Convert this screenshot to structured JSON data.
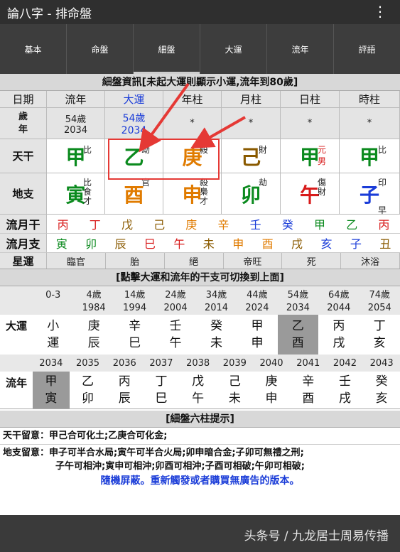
{
  "app_title": "論八字 - 排命盤",
  "tabs": [
    "基本",
    "命盤",
    "細盤",
    "大運",
    "流年",
    "評語"
  ],
  "detail_title": "細盤資訊[未起大運則顯示小運,流年到80歲]",
  "headers": [
    "日期",
    "流年",
    "大運",
    "年柱",
    "月柱",
    "日柱",
    "時柱"
  ],
  "age_label": "歲\n年",
  "age_row": [
    {
      "a": "54歲",
      "y": "2034"
    },
    {
      "a": "54歲",
      "y": "2034"
    },
    "*",
    "*",
    "*",
    "*"
  ],
  "stem_label": "天干",
  "stems": [
    {
      "c": "甲",
      "color": "#0b8a1e",
      "note": "比"
    },
    {
      "c": "乙",
      "color": "#0b8a1e",
      "note": "劫"
    },
    {
      "c": "庚",
      "color": "#e07b00",
      "note": "殺"
    },
    {
      "c": "己",
      "color": "#8a5a00",
      "note": "財"
    },
    {
      "c": "甲",
      "color": "#0b8a1e",
      "note": "元",
      "note2": "男"
    },
    {
      "c": "甲",
      "color": "#0b8a1e",
      "note": "比"
    }
  ],
  "branch_label": "地支",
  "branches": [
    {
      "c": "寅",
      "color": "#0b8a1e",
      "notes": [
        "比",
        "食",
        "才"
      ]
    },
    {
      "c": "酉",
      "color": "#e07b00",
      "notes": [
        "官"
      ]
    },
    {
      "c": "申",
      "color": "#e07b00",
      "notes": [
        "殺",
        "梟",
        "才"
      ]
    },
    {
      "c": "卯",
      "color": "#0b8a1e",
      "notes": [
        "劫"
      ]
    },
    {
      "c": "午",
      "color": "#d81b1b",
      "notes": [
        "傷",
        "財"
      ]
    },
    {
      "c": "子",
      "color": "#1a3cd8",
      "notes": [
        "印",
        "",
        "",
        "早"
      ]
    }
  ],
  "month_stem_label": "流月干",
  "month_stems": [
    [
      "丙",
      "#d81b1b"
    ],
    [
      "丁",
      "#d81b1b"
    ],
    [
      "戊",
      "#8a5a00"
    ],
    [
      "己",
      "#8a5a00"
    ],
    [
      "庚",
      "#e07b00"
    ],
    [
      "辛",
      "#e07b00"
    ],
    [
      "壬",
      "#1a3cd8"
    ],
    [
      "癸",
      "#1a3cd8"
    ],
    [
      "甲",
      "#0b8a1e"
    ],
    [
      "乙",
      "#0b8a1e"
    ],
    [
      "丙",
      "#d81b1b"
    ]
  ],
  "month_branch_label": "流月支",
  "month_branches": [
    [
      "寅",
      "#0b8a1e"
    ],
    [
      "卯",
      "#0b8a1e"
    ],
    [
      "辰",
      "#8a5a00"
    ],
    [
      "巳",
      "#d81b1b"
    ],
    [
      "午",
      "#d81b1b"
    ],
    [
      "未",
      "#8a5a00"
    ],
    [
      "申",
      "#e07b00"
    ],
    [
      "酉",
      "#e07b00"
    ],
    [
      "戌",
      "#8a5a00"
    ],
    [
      "亥",
      "#1a3cd8"
    ],
    [
      "子",
      "#1a3cd8"
    ],
    [
      "丑",
      "#8a5a00"
    ]
  ],
  "star_label": "星運",
  "stars": [
    "臨官",
    "胎",
    "絕",
    "帝旺",
    "死",
    "沐浴"
  ],
  "dayun_title": "[點擊大運和流年的干支可切換到上面]",
  "dayun_ages": [
    "0-3",
    "4歲",
    "14歲",
    "24歲",
    "34歲",
    "44歲",
    "54歲",
    "64歲",
    "74歲"
  ],
  "dayun_years": [
    "",
    "1984",
    "1994",
    "2004",
    "2014",
    "2024",
    "2034",
    "2044",
    "2054"
  ],
  "dayun_label": "大運",
  "dayun": [
    [
      "小",
      "運"
    ],
    [
      "庚",
      "辰"
    ],
    [
      "辛",
      "巳"
    ],
    [
      "壬",
      "午"
    ],
    [
      "癸",
      "未"
    ],
    [
      "甲",
      "申"
    ],
    [
      "乙",
      "酉"
    ],
    [
      "丙",
      "戌"
    ],
    [
      "丁",
      "亥"
    ]
  ],
  "liunian_years": [
    "2034",
    "2035",
    "2036",
    "2037",
    "2038",
    "2039",
    "2040",
    "2041",
    "2042",
    "2043"
  ],
  "liunian_label": "流年",
  "liunian": [
    [
      "甲",
      "寅"
    ],
    [
      "乙",
      "卯"
    ],
    [
      "丙",
      "辰"
    ],
    [
      "丁",
      "巳"
    ],
    [
      "戊",
      "午"
    ],
    [
      "己",
      "未"
    ],
    [
      "庚",
      "申"
    ],
    [
      "辛",
      "酉"
    ],
    [
      "壬",
      "戌"
    ],
    [
      "癸",
      "亥"
    ]
  ],
  "tips_title": "[細盤六柱提示]",
  "tip1": "天干留意：甲己合可化土;乙庚合可化金;",
  "tip2a": "地支留意：申子可半合水局;寅午可半合火局;卯申暗合金;子卯可無禮之刑;",
  "tip2b": "子午可相沖;寅申可相沖;卯酉可相沖;子酉可相破;午卯可相破;",
  "ad_text": "隨機屏蔽。重新觸發或者購買無廣告的版本。",
  "watermark": "头条号 / 九龙居士周易传播"
}
